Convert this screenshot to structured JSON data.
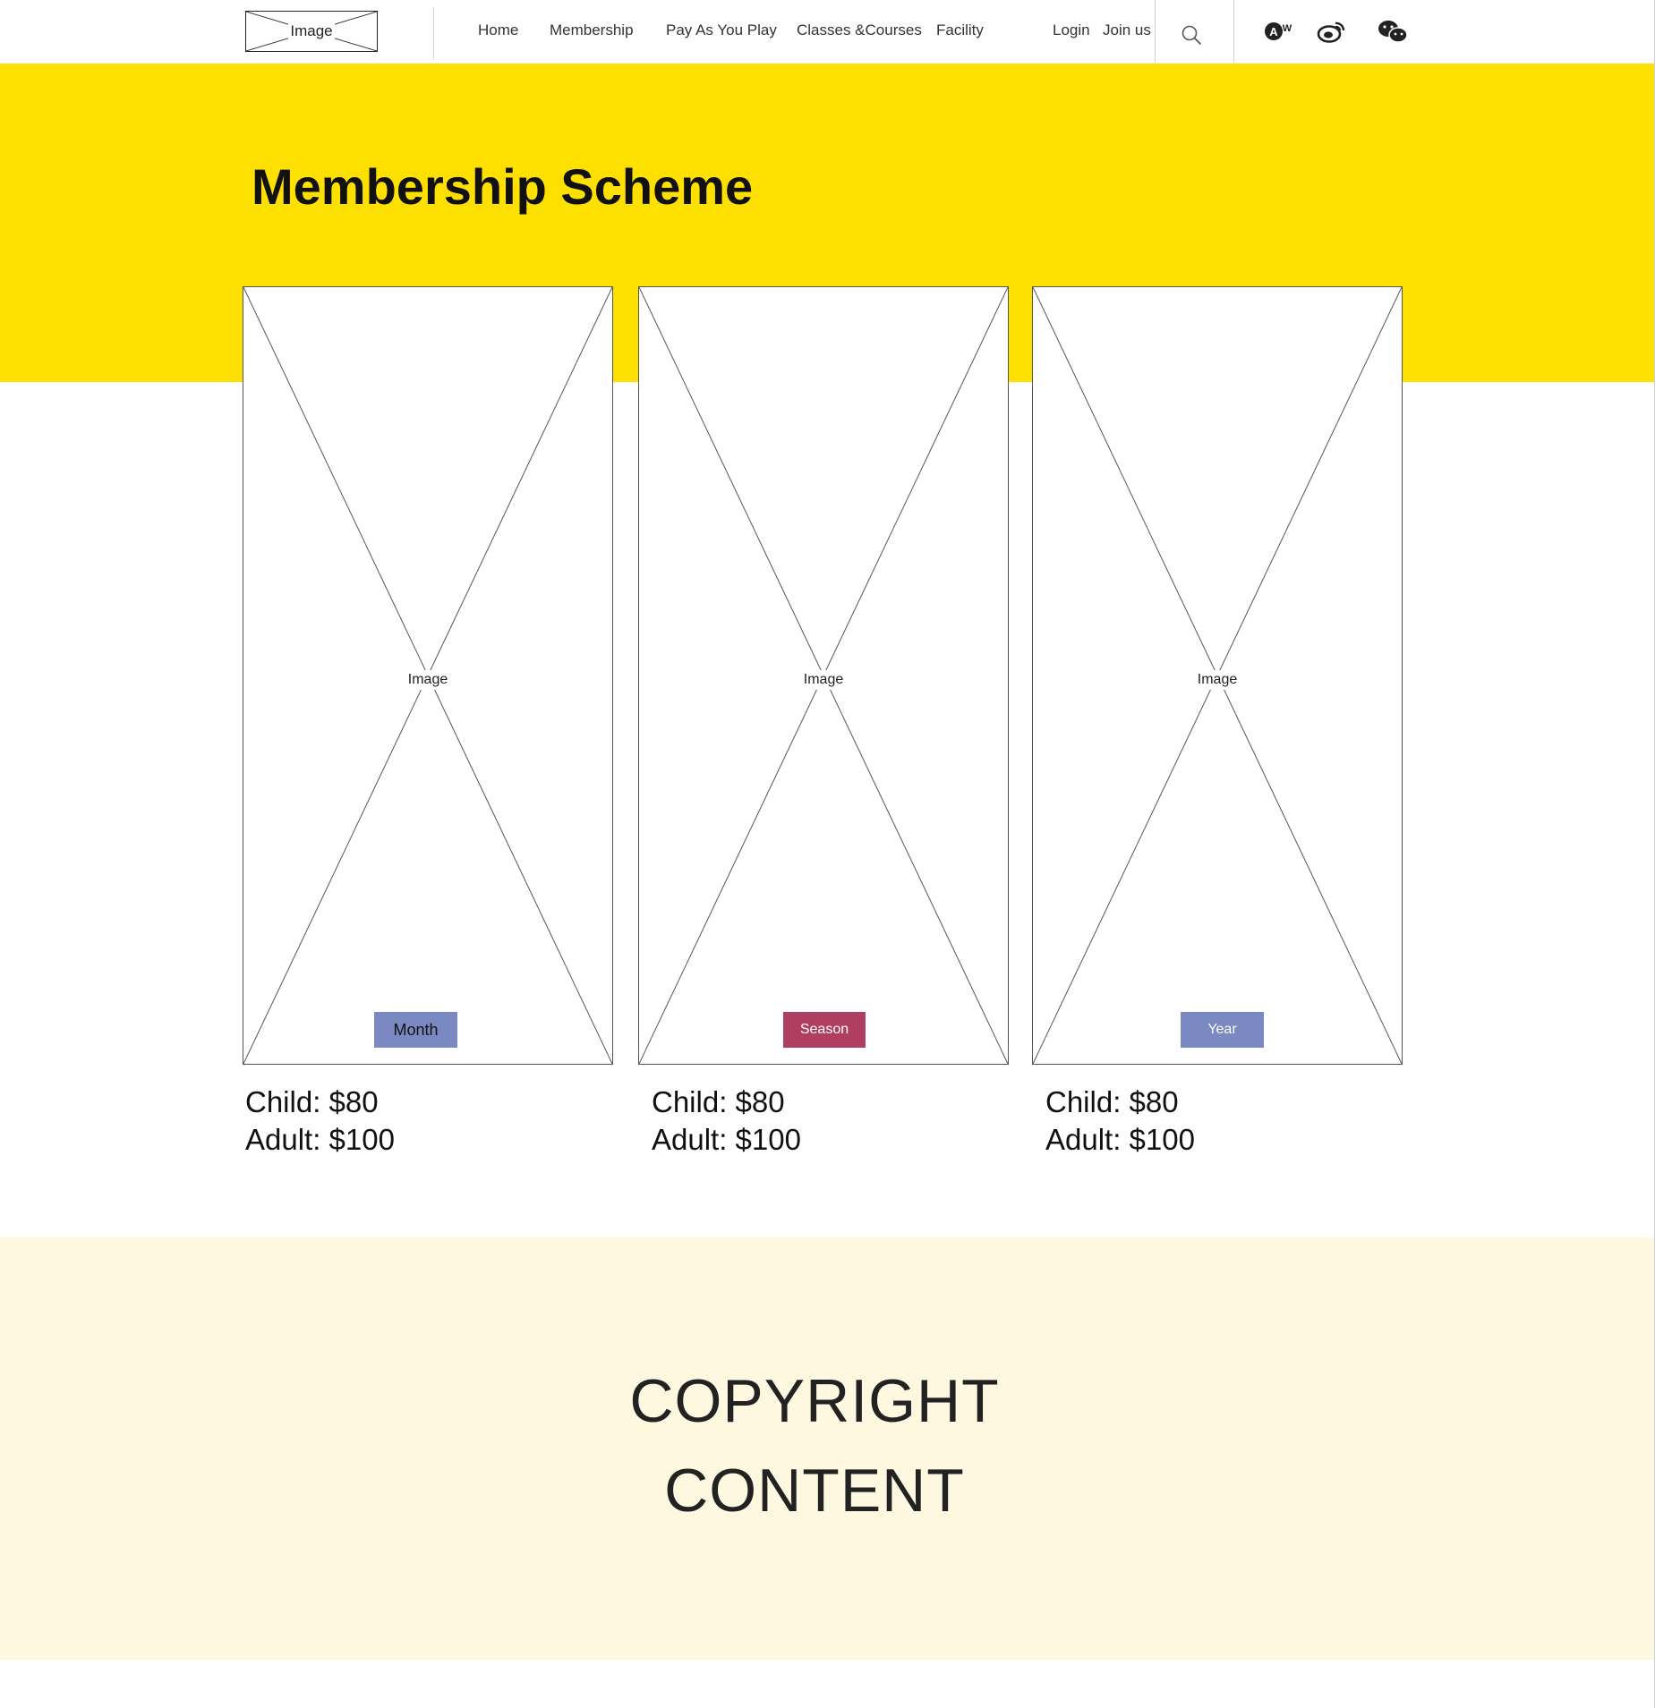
{
  "header": {
    "logo_label": "Image",
    "nav": [
      "Home",
      "Membership",
      "Pay As You Play",
      "Classes &Courses",
      "Facility"
    ],
    "login_label": "Login",
    "join_label": "Join us",
    "icons": [
      "search-icon",
      "aw-icon",
      "weibo-icon",
      "wechat-icon"
    ]
  },
  "hero": {
    "title": "Membership Scheme",
    "background_color": "#FEE000"
  },
  "plans": [
    {
      "image_label": "Image",
      "button_label": "Month",
      "button_color": "#7B89C2",
      "child_price": "Child: $80",
      "adult_price": "Adult: $100"
    },
    {
      "image_label": "Image",
      "button_label": "Season",
      "button_color": "#B03E62",
      "child_price": "Child: $80",
      "adult_price": "Adult: $100"
    },
    {
      "image_label": "Image",
      "button_label": "Year",
      "button_color": "#7B89C2",
      "child_price": "Child: $80",
      "adult_price": "Adult: $100"
    }
  ],
  "footer": {
    "line1": "COPYRIGHT",
    "line2": "CONTENT",
    "background_color": "#FDF8DF"
  }
}
